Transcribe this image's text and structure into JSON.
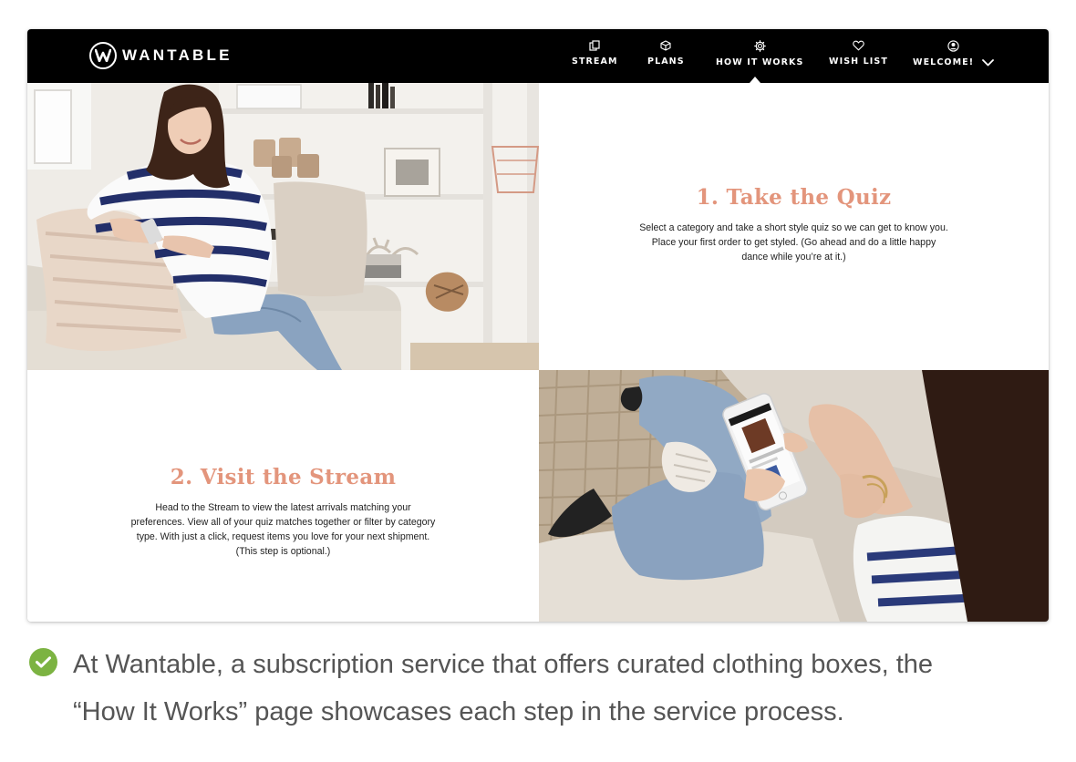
{
  "brand": {
    "name": "WANTABLE"
  },
  "nav": {
    "items": [
      {
        "label": "STREAM",
        "icon": "stream-icon"
      },
      {
        "label": "PLANS",
        "icon": "box-icon"
      },
      {
        "label": "HOW IT WORKS",
        "icon": "gear-icon"
      },
      {
        "label": "WISH LIST",
        "icon": "heart-icon"
      },
      {
        "label": "WELCOME!",
        "icon": "user-icon"
      }
    ],
    "active": "HOW IT WORKS"
  },
  "steps": [
    {
      "title": "1. Take the Quiz",
      "lines": [
        "Select a category and take a short style quiz so we can get to know you.",
        "Place your first order to get styled. (Go ahead and do a little happy",
        "dance while you’re at it.)"
      ]
    },
    {
      "title": "2. Visit the Stream",
      "lines": [
        "Head to the Stream to view the latest arrivals matching your",
        "preferences. View all of your quiz matches together or filter by category",
        "type. With just a click, request items you love for your next shipment.",
        "(This step is optional.)"
      ]
    }
  ],
  "caption": {
    "line1": "At Wantable, a subscription service that offers curated clothing boxes, the",
    "line2": "“How It Works” page showcases each step in the service process."
  },
  "colors": {
    "nav_bg": "#000000",
    "step_title": "#e3957c",
    "check": "#7cb342",
    "caption_text": "#555555"
  }
}
